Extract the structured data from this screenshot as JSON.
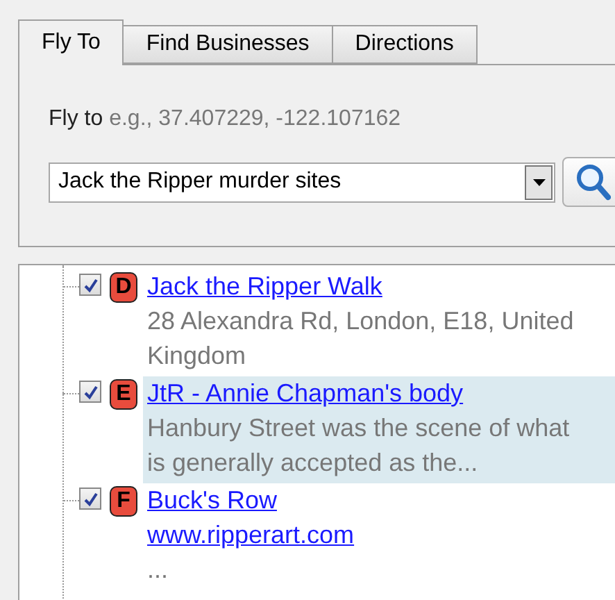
{
  "tabs": [
    {
      "label": "Fly To",
      "selected": true
    },
    {
      "label": "Find Businesses",
      "selected": false
    },
    {
      "label": "Directions",
      "selected": false
    }
  ],
  "fly_to": {
    "label": "Fly to",
    "hint": "e.g., 37.407229, -122.107162",
    "value": "Jack the Ripper murder sites"
  },
  "results": [
    {
      "marker": "D",
      "title": "Jack the Ripper Walk",
      "checked": true,
      "selected": false,
      "lines": [
        {
          "kind": "text",
          "text": "28 Alexandra Rd, London, E18, United"
        },
        {
          "kind": "text",
          "text": "Kingdom"
        }
      ]
    },
    {
      "marker": "E",
      "title": "JtR - Annie Chapman's body",
      "checked": true,
      "selected": true,
      "lines": [
        {
          "kind": "text",
          "text": "Hanbury Street was the scene of what"
        },
        {
          "kind": "text",
          "text": "is generally accepted as the..."
        }
      ]
    },
    {
      "marker": "F",
      "title": "Buck's Row",
      "checked": true,
      "selected": false,
      "lines": [
        {
          "kind": "link",
          "text": "www.ripperart.com"
        },
        {
          "kind": "text",
          "text": "..."
        }
      ]
    }
  ]
}
